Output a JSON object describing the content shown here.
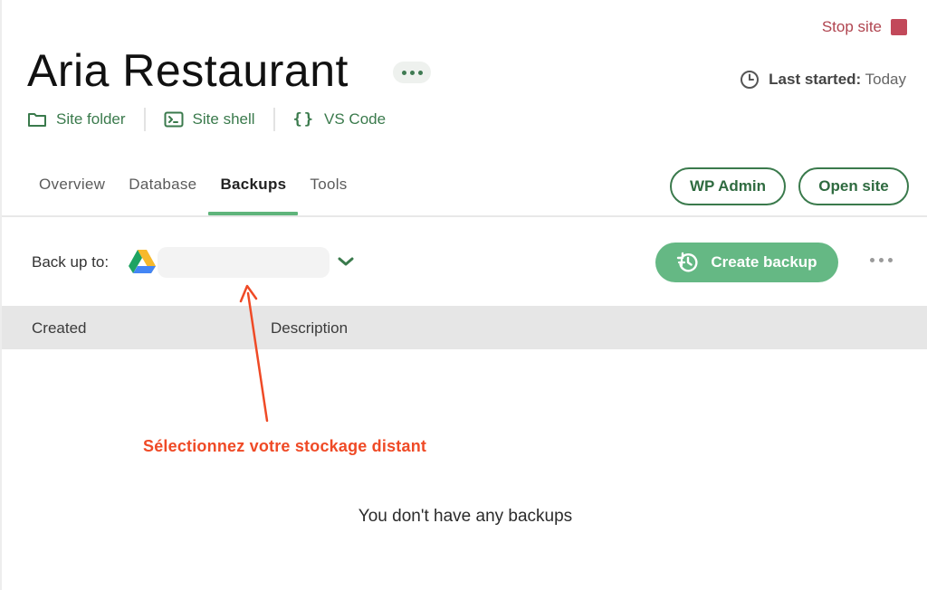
{
  "header": {
    "stop_site_label": "Stop site",
    "site_title": "Aria Restaurant",
    "last_started_label": "Last started:",
    "last_started_value": "Today",
    "links": [
      {
        "label": "Site folder",
        "icon": "folder-icon"
      },
      {
        "label": "Site shell",
        "icon": "terminal-icon"
      },
      {
        "label": "VS Code",
        "icon": "code-braces-icon"
      }
    ]
  },
  "tabs": [
    {
      "label": "Overview",
      "active": false
    },
    {
      "label": "Database",
      "active": false
    },
    {
      "label": "Backups",
      "active": true
    },
    {
      "label": "Tools",
      "active": false
    }
  ],
  "actions": {
    "wp_admin_label": "WP Admin",
    "open_site_label": "Open site"
  },
  "backups": {
    "back_up_to_label": "Back up to:",
    "storage_provider_icon": "google-drive-icon",
    "storage_selected_value": "",
    "create_backup_label": "Create backup",
    "table_columns": [
      "Created",
      "Description"
    ],
    "empty_message": "You don't have any backups"
  },
  "annotation": {
    "text": "Sélectionnez votre stockage distant",
    "color": "#ef4a26"
  },
  "colors": {
    "accent_green": "#3a7a4c",
    "button_green": "#65b884",
    "tab_underline": "#5fb47b",
    "stop_red": "#c2495a"
  }
}
